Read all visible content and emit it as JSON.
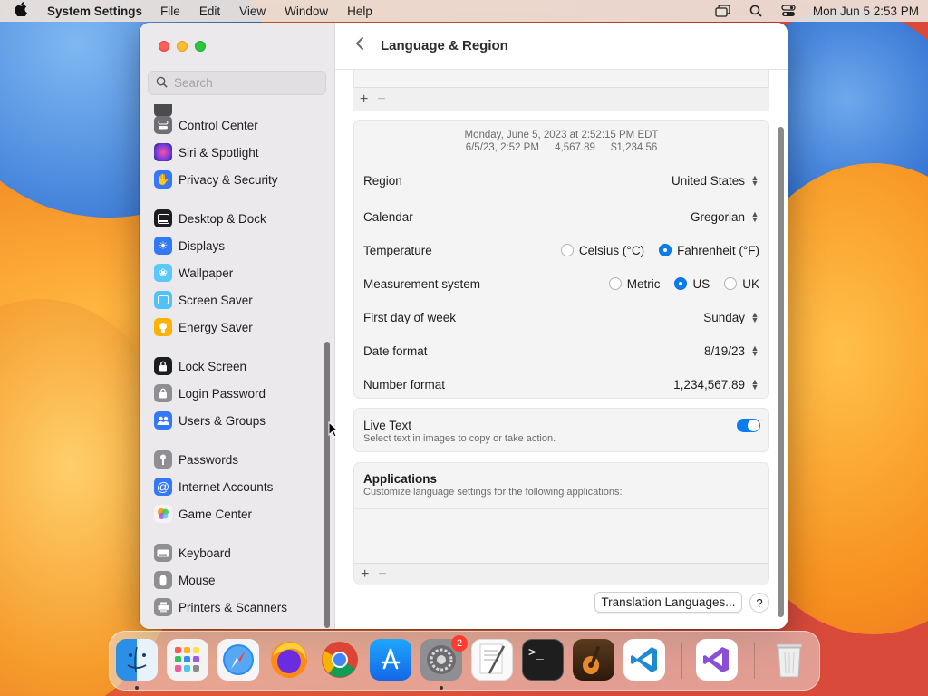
{
  "menubar": {
    "app_name": "System Settings",
    "menus": [
      "File",
      "Edit",
      "View",
      "Window",
      "Help"
    ],
    "clock": "Mon Jun 5  2:53 PM"
  },
  "sidebar": {
    "search_placeholder": "Search",
    "items": [
      {
        "label": "Control Center",
        "icon": "control-center-icon",
        "color": "#6e6e73"
      },
      {
        "label": "Siri & Spotlight",
        "icon": "siri-icon",
        "color": "#8e44ad"
      },
      {
        "label": "Privacy & Security",
        "icon": "hand-icon",
        "color": "#3478f6"
      },
      {
        "label": "Desktop & Dock",
        "icon": "dock-icon",
        "color": "#1d1d1f"
      },
      {
        "label": "Displays",
        "icon": "sun-icon",
        "color": "#3478f6"
      },
      {
        "label": "Wallpaper",
        "icon": "flower-icon",
        "color": "#5ac8fa"
      },
      {
        "label": "Screen Saver",
        "icon": "screen-saver-icon",
        "color": "#4fc3f7"
      },
      {
        "label": "Energy Saver",
        "icon": "bulb-icon",
        "color": "#ffb300"
      },
      {
        "label": "Lock Screen",
        "icon": "lock-icon",
        "color": "#1d1d1f"
      },
      {
        "label": "Login Password",
        "icon": "lock-icon",
        "color": "#8e8e93"
      },
      {
        "label": "Users & Groups",
        "icon": "users-icon",
        "color": "#3478f6"
      },
      {
        "label": "Passwords",
        "icon": "key-icon",
        "color": "#8e8e93"
      },
      {
        "label": "Internet Accounts",
        "icon": "at-icon",
        "color": "#3478f6"
      },
      {
        "label": "Game Center",
        "icon": "game-center-icon",
        "color": "#ff9f0a"
      },
      {
        "label": "Keyboard",
        "icon": "keyboard-icon",
        "color": "#8e8e93"
      },
      {
        "label": "Mouse",
        "icon": "mouse-icon",
        "color": "#8e8e93"
      },
      {
        "label": "Printers & Scanners",
        "icon": "printer-icon",
        "color": "#8e8e93"
      }
    ]
  },
  "header": {
    "title": "Language & Region"
  },
  "preview": {
    "line1": "Monday, June 5, 2023 at 2:52:15 PM EDT",
    "short_date": "6/5/23, 2:52 PM",
    "number": "4,567.89",
    "currency": "$1,234.56"
  },
  "settings": {
    "region": {
      "label": "Region",
      "value": "United States"
    },
    "calendar": {
      "label": "Calendar",
      "value": "Gregorian"
    },
    "temperature": {
      "label": "Temperature",
      "options": [
        "Celsius (°C)",
        "Fahrenheit (°F)"
      ],
      "selected": "Fahrenheit (°F)"
    },
    "measurement": {
      "label": "Measurement system",
      "options": [
        "Metric",
        "US",
        "UK"
      ],
      "selected": "US"
    },
    "first_day": {
      "label": "First day of week",
      "value": "Sunday"
    },
    "date_format": {
      "label": "Date format",
      "value": "8/19/23"
    },
    "number_format": {
      "label": "Number format",
      "value": "1,234,567.89"
    }
  },
  "live_text": {
    "title": "Live Text",
    "subtitle": "Select text in images to copy or take action.",
    "enabled": true
  },
  "applications": {
    "title": "Applications",
    "subtitle": "Customize language settings for the following applications:"
  },
  "buttons": {
    "add": "+",
    "remove": "−",
    "translation": "Translation Languages...",
    "help": "?"
  },
  "dock": {
    "apps": [
      "Finder",
      "Launchpad",
      "Safari",
      "Firefox",
      "Chrome",
      "App Store",
      "System Settings",
      "TextEdit",
      "Terminal",
      "GarageBand",
      "Visual Studio Code",
      "Visual Studio",
      "Trash"
    ],
    "settings_badge": "2"
  }
}
